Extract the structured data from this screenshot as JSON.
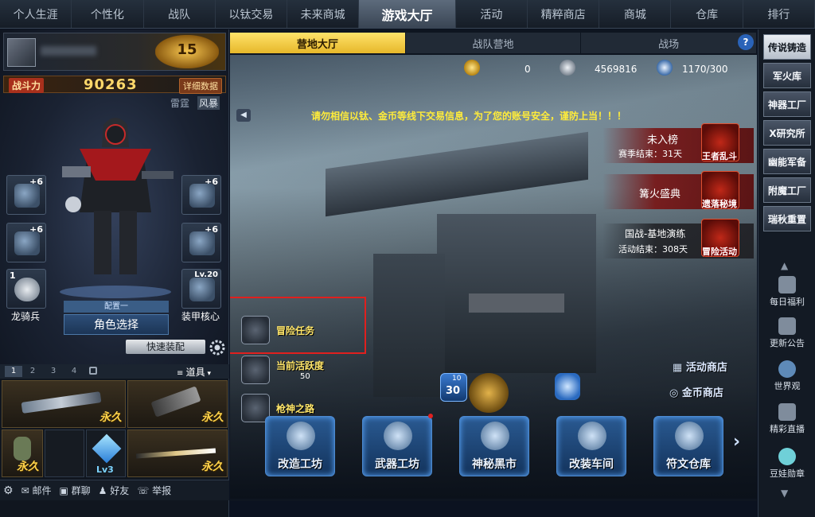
{
  "topnav": [
    "个人生涯",
    "个性化",
    "战队",
    "以钛交易",
    "未来商城",
    "游戏大厅",
    "活动",
    "精粹商店",
    "商城",
    "仓库",
    "排行"
  ],
  "topnav_active_index": 5,
  "player": {
    "rank_level": "15"
  },
  "power": {
    "label": "战斗力",
    "value": "90263",
    "detail": "详细数据"
  },
  "modes": {
    "a": "雷霆",
    "b": "风暴"
  },
  "equip": {
    "plus": "+6",
    "level": "Lv.20",
    "count": "1",
    "char_name": "龙骑兵",
    "armor_name": "装甲核心"
  },
  "character": {
    "config": "配置一",
    "select": "角色选择",
    "quick_equip": "快速装配"
  },
  "inventory": {
    "tabs": [
      "1",
      "2",
      "3",
      "4"
    ],
    "props": "道具",
    "perm": "永久",
    "lv": "Lv3"
  },
  "social": {
    "mail": "邮件",
    "group": "群聊",
    "friends": "好友",
    "report": "举报"
  },
  "subtabs": [
    "营地大厅",
    "战队营地",
    "战场"
  ],
  "subtab_active_index": 0,
  "help": "?",
  "resources": {
    "coin": "0",
    "silver": "4569816",
    "energy": "1170/300"
  },
  "notice": "请勿相信以钛、金币等线下交易信息，为了您的账号安全，谨防上当！！！",
  "events": [
    {
      "title": "未入榜",
      "sub": "赛季结束：31天",
      "icon_label": "王者乱斗"
    },
    {
      "title": "篝火盛典",
      "sub": "",
      "icon_label": "遗落秘境"
    },
    {
      "title": "国战-基地演练",
      "sub": "活动结束：308天",
      "icon_label": "冒险活动"
    }
  ],
  "quests": [
    {
      "label": "冒险任务",
      "sub": ""
    },
    {
      "label": "当前活跃度",
      "sub": "50"
    },
    {
      "label": "枪神之路",
      "sub": ""
    }
  ],
  "badges": {
    "sign_day": "30",
    "sign_top": "10"
  },
  "shops": {
    "activity": "活动商店",
    "gold": "金币商店"
  },
  "tools": [
    "改造工坊",
    "武器工坊",
    "神秘黑市",
    "改装车间",
    "符文仓库"
  ],
  "right_buttons": [
    "传说铸造",
    "军火库",
    "神器工厂",
    "X研究所",
    "幽能军备",
    "附魔工厂",
    "瑞秋重置"
  ],
  "right_icons": [
    "每日福利",
    "更新公告",
    "世界观",
    "精彩直播",
    "豆娃勋章"
  ],
  "colors": {
    "notice": "#ffec3a",
    "power": "#ffd86a",
    "active_subtab": "#e6b72a",
    "red_box": "#e0201e"
  }
}
